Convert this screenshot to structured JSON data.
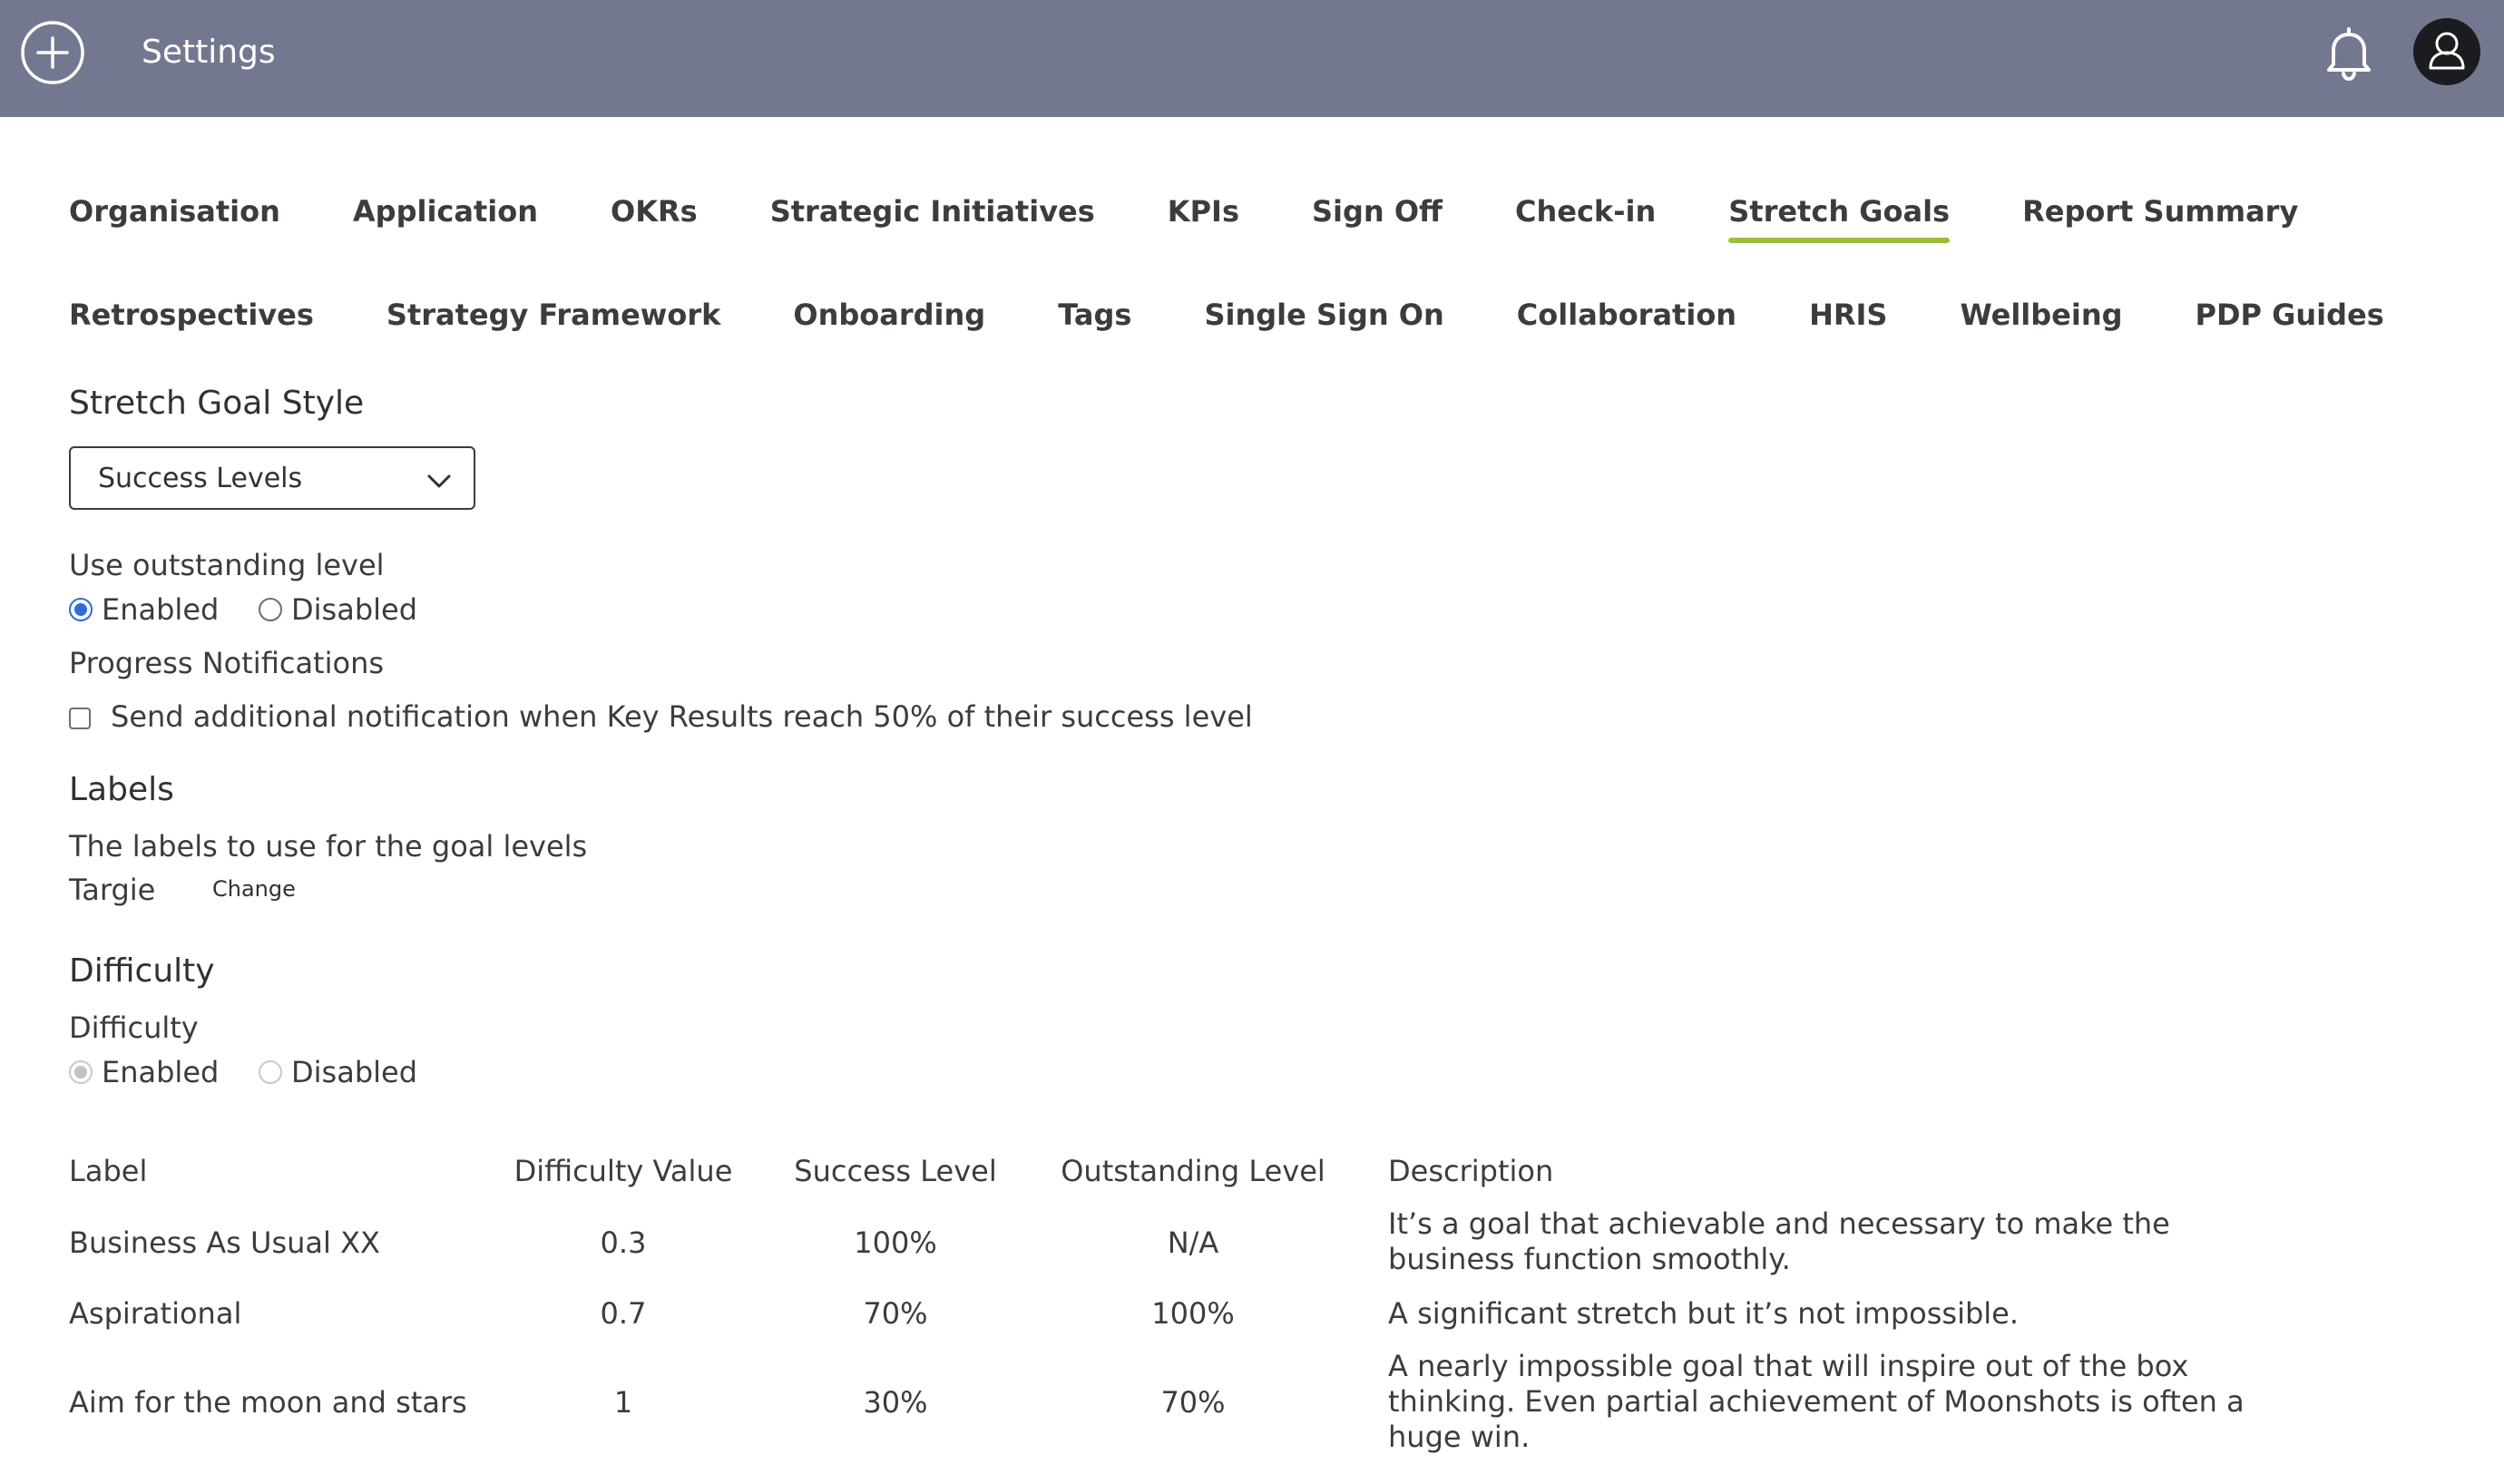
{
  "header": {
    "title": "Settings",
    "icons": [
      "plus-circle-icon",
      "bell-icon",
      "user-icon"
    ],
    "bar_color": "#737890"
  },
  "tabs": [
    {
      "label": "Organisation",
      "active": false
    },
    {
      "label": "Application",
      "active": false
    },
    {
      "label": "OKRs",
      "active": false
    },
    {
      "label": "Strategic Initiatives",
      "active": false
    },
    {
      "label": "KPIs",
      "active": false
    },
    {
      "label": "Sign Off",
      "active": false
    },
    {
      "label": "Check-in",
      "active": false
    },
    {
      "label": "Stretch Goals",
      "active": true
    },
    {
      "label": "Report Summary",
      "active": false
    },
    {
      "label": "Retrospectives",
      "active": false
    },
    {
      "label": "Strategy Framework",
      "active": false
    },
    {
      "label": "Onboarding",
      "active": false
    },
    {
      "label": "Tags",
      "active": false
    },
    {
      "label": "Single Sign On",
      "active": false
    },
    {
      "label": "Collaboration",
      "active": false
    },
    {
      "label": "HRIS",
      "active": false
    },
    {
      "label": "Wellbeing",
      "active": false
    },
    {
      "label": "PDP Guides",
      "active": false
    }
  ],
  "active_tab_underline_color": "#9bbf3a",
  "style_section": {
    "heading": "Stretch Goal Style",
    "selected": "Success Levels"
  },
  "outstanding": {
    "label": "Use outstanding level",
    "enabled_label": "Enabled",
    "disabled_label": "Disabled",
    "value": "Enabled"
  },
  "progress": {
    "label": "Progress Notifications",
    "checkbox_label": "Send additional notification when Key Results reach 50% of their success level",
    "checked": false
  },
  "labels_section": {
    "heading": "Labels",
    "description": "The labels to use for the goal levels",
    "current": "Targie",
    "change_link": "Change"
  },
  "difficulty_section": {
    "heading": "Difficulty",
    "label": "Difficulty",
    "enabled_label": "Enabled",
    "disabled_label": "Disabled",
    "value": "Enabled",
    "disabled": true
  },
  "table": {
    "headers": [
      "Label",
      "Difficulty Value",
      "Success Level",
      "Outstanding Level",
      "Description"
    ],
    "rows": [
      [
        "Business As Usual XX",
        "0.3",
        "100%",
        "N/A",
        "It’s a goal that achievable and necessary to make the business function smoothly."
      ],
      [
        "Aspirational",
        "0.7",
        "70%",
        "100%",
        "A significant stretch but it’s not impossible."
      ],
      [
        "Aim for the moon and stars",
        "1",
        "30%",
        "70%",
        "A nearly impossible goal that will inspire out of the box thinking. Even partial achievement of Moonshots is often a huge win."
      ]
    ]
  }
}
